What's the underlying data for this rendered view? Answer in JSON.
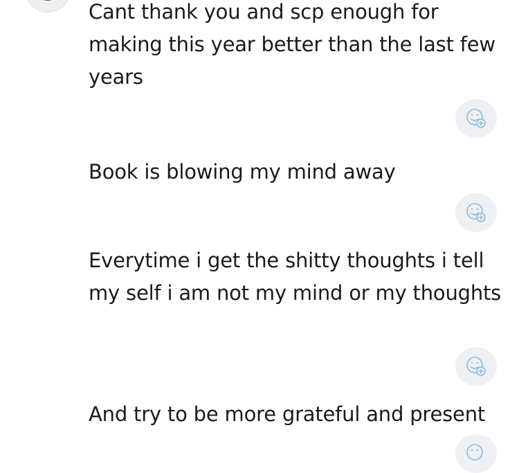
{
  "sender": {
    "avatar_icon": "user-avatar"
  },
  "messages": [
    {
      "text": "Cant thank you and scp enough for making this year better than the last few years"
    },
    {
      "text": "Book is blowing my mind away"
    },
    {
      "text": "Everytime i get the shitty thoughts i tell my self i am not my mind or my thoughts"
    },
    {
      "text": "And try to be more grateful and present"
    }
  ],
  "reaction_button": {
    "icon": "add-reaction-icon",
    "icon_color": "#8fb9d9",
    "background": "#eef0f4"
  }
}
